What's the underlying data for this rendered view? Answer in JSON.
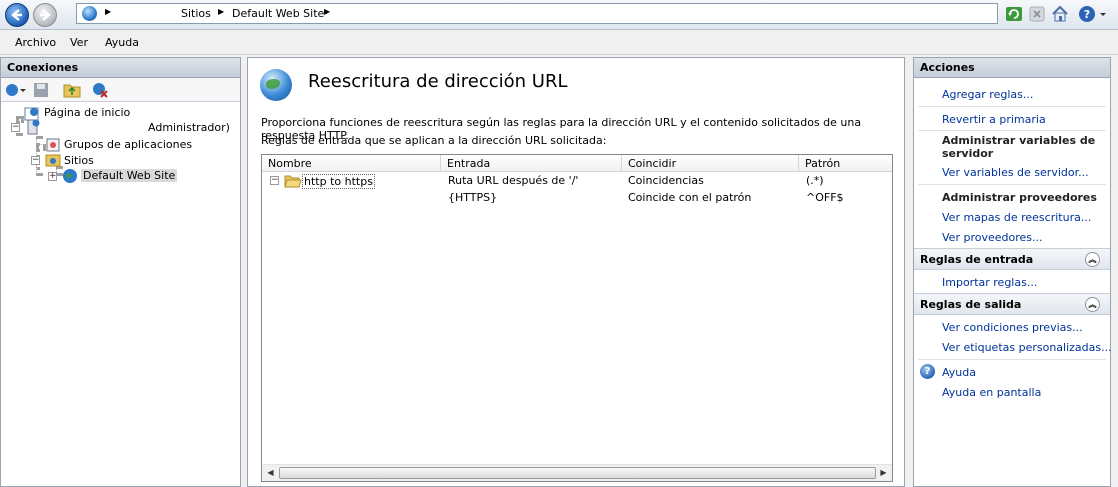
{
  "address": {
    "crumbs": [
      "Sitios",
      "Default Web Site"
    ],
    "separators": [
      "▶",
      "▶",
      "▶"
    ]
  },
  "menu": [
    "Archivo",
    "Ver",
    "Ayuda"
  ],
  "connections": {
    "title": "Conexiones",
    "tree": {
      "start_page": "Página de inicio",
      "server": "Administrador)",
      "app_pools": "Grupos de aplicaciones",
      "sites": "Sitios",
      "site": "Default Web Site"
    }
  },
  "main": {
    "title": "Reescritura de dirección URL",
    "description": "Proporciona funciones de reescritura según las reglas para la dirección URL y el contenido solicitados de una respuesta HTTP.",
    "subdescription": "Reglas de entrada que se aplican a la dirección URL solicitada:",
    "columns": [
      "Nombre",
      "Entrada",
      "Coincidir",
      "Patrón"
    ],
    "rows": [
      {
        "name": "http to https",
        "input": "Ruta URL después de '/'",
        "match": "Coincidencias",
        "pattern": "(.*)"
      },
      {
        "name": "",
        "input": "{HTTPS}",
        "match": "Coincide con el patrón",
        "pattern": "^OFF$"
      }
    ]
  },
  "actions": {
    "title": "Acciones",
    "add_rules": "Agregar reglas...",
    "revert": "Revertir a primaria",
    "server_vars_head": "Administrar variables de servidor",
    "view_server_vars": "Ver variables de servidor...",
    "providers_head": "Administrar proveedores",
    "view_rewrite_maps": "Ver mapas de reescritura...",
    "view_providers": "Ver proveedores...",
    "inbound_section": "Reglas de entrada",
    "import_rules": "Importar reglas...",
    "outbound_section": "Reglas de salida",
    "view_preconditions": "Ver condiciones previas...",
    "view_custom_tags": "Ver etiquetas personalizadas...",
    "help": "Ayuda",
    "online_help": "Ayuda en pantalla"
  },
  "colors": {
    "link": "#003399",
    "panel_border": "#9aa4b0"
  }
}
